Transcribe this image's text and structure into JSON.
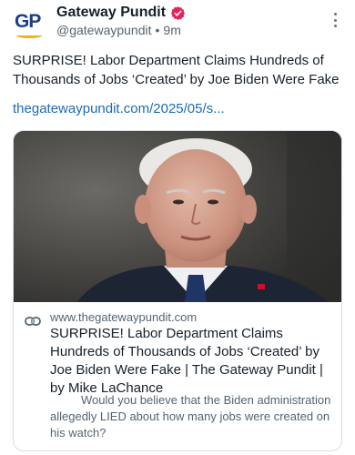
{
  "post": {
    "author": {
      "display_name": "Gateway Pundit",
      "handle": "@gatewaypundit",
      "timestamp": "9m",
      "avatar_text": "GP",
      "verified": true
    },
    "text": "SURPRISE! Labor Department Claims Hundreds of Thousands of Jobs ‘Created’ by Joe Biden Were Fake",
    "link": "thegatewaypundit.com/2025/05/s..."
  },
  "card": {
    "domain": "www.thegatewaypundit.com",
    "title": "SURPRISE! Labor Department Claims Hundreds of Thousands of Jobs ‘Created’ by Joe Biden Were Fake | The Gateway Pundit | by Mike LaChance",
    "description": "Would you believe that the Biden administration allegedly LIED about how many jobs were created on his watch?"
  },
  "colors": {
    "link": "#1e6ab5",
    "verified": "#e0245e",
    "text": "#15202b",
    "muted": "#536471"
  },
  "icons": {
    "verified": "verified-badge-icon",
    "more": "more-vertical-icon",
    "link": "link-icon"
  }
}
